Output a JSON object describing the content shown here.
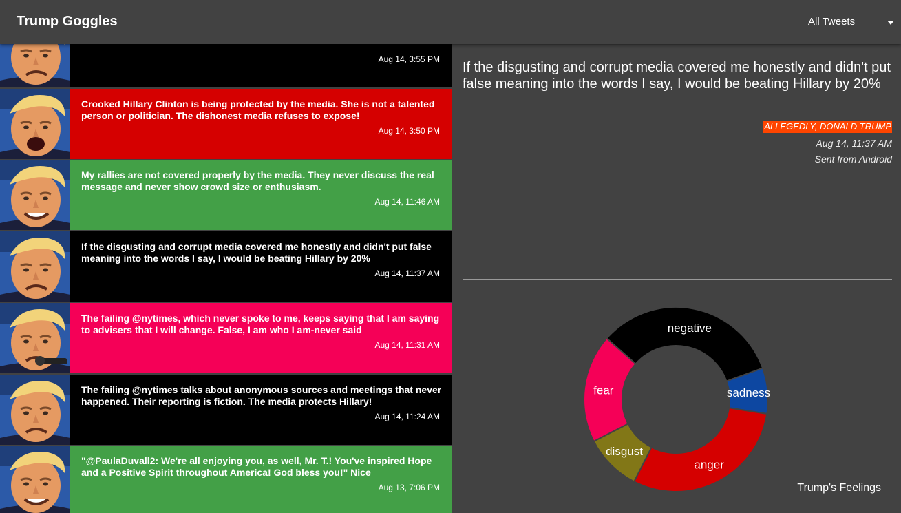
{
  "app": {
    "title": "Trump Goggles"
  },
  "filter": {
    "selected": "All Tweets"
  },
  "tweets": [
    {
      "text": "",
      "time": "Aug 14, 3:55 PM",
      "color": "#000000",
      "expression": "frown"
    },
    {
      "text": "Crooked Hillary Clinton is being protected by the media. She is not a talented person or politician. The dishonest media refuses to expose!",
      "time": "Aug 14, 3:50 PM",
      "color": "#d50000",
      "expression": "shout"
    },
    {
      "text": "My rallies are not covered properly by the media. They never discuss the real message and never show crowd size or enthusiasm.",
      "time": "Aug 14, 11:46 AM",
      "color": "#43a047",
      "expression": "smile"
    },
    {
      "text": "If the disgusting and corrupt media covered me honestly and didn't put false meaning into the words I say, I would be beating Hillary by 20%",
      "time": "Aug 14, 11:37 AM",
      "color": "#000000",
      "expression": "frown"
    },
    {
      "text": "The failing @nytimes, which never spoke to me, keeps saying that I am saying to advisers that I will change. False, I am who I am-never said",
      "time": "Aug 14, 11:31 AM",
      "color": "#f50057",
      "expression": "mic"
    },
    {
      "text": "The failing @nytimes talks about anonymous sources and meetings that never happened. Their reporting is fiction. The media protects Hillary!",
      "time": "Aug 14, 11:24 AM",
      "color": "#000000",
      "expression": "frown"
    },
    {
      "text": "\"@PaulaDuvall2: We're all enjoying you, as well, Mr. T.! You've inspired Hope and a Positive Spirit throughout America! God bless you!\" Nice",
      "time": "Aug 13, 7:06 PM",
      "color": "#43a047",
      "expression": "smile"
    }
  ],
  "selected_tweet": {
    "text": "If the disgusting and corrupt media covered me honestly and didn't put false meaning into the words I say, I would be beating Hillary by 20%",
    "author_badge": "ALLEGEDLY, DONALD TRUMP",
    "time": "Aug 14, 11:37 AM",
    "source": "Sent from Android"
  },
  "chart_title": "Trump's Feelings",
  "chart_data": {
    "type": "pie",
    "title": "",
    "labels": [
      "negative",
      "sadness",
      "anger",
      "disgust",
      "fear"
    ],
    "values": [
      33,
      8,
      30,
      10,
      19
    ],
    "colors": [
      "#000000",
      "#0d47a1",
      "#d50000",
      "#827717",
      "#f50057"
    ],
    "donut": true
  }
}
